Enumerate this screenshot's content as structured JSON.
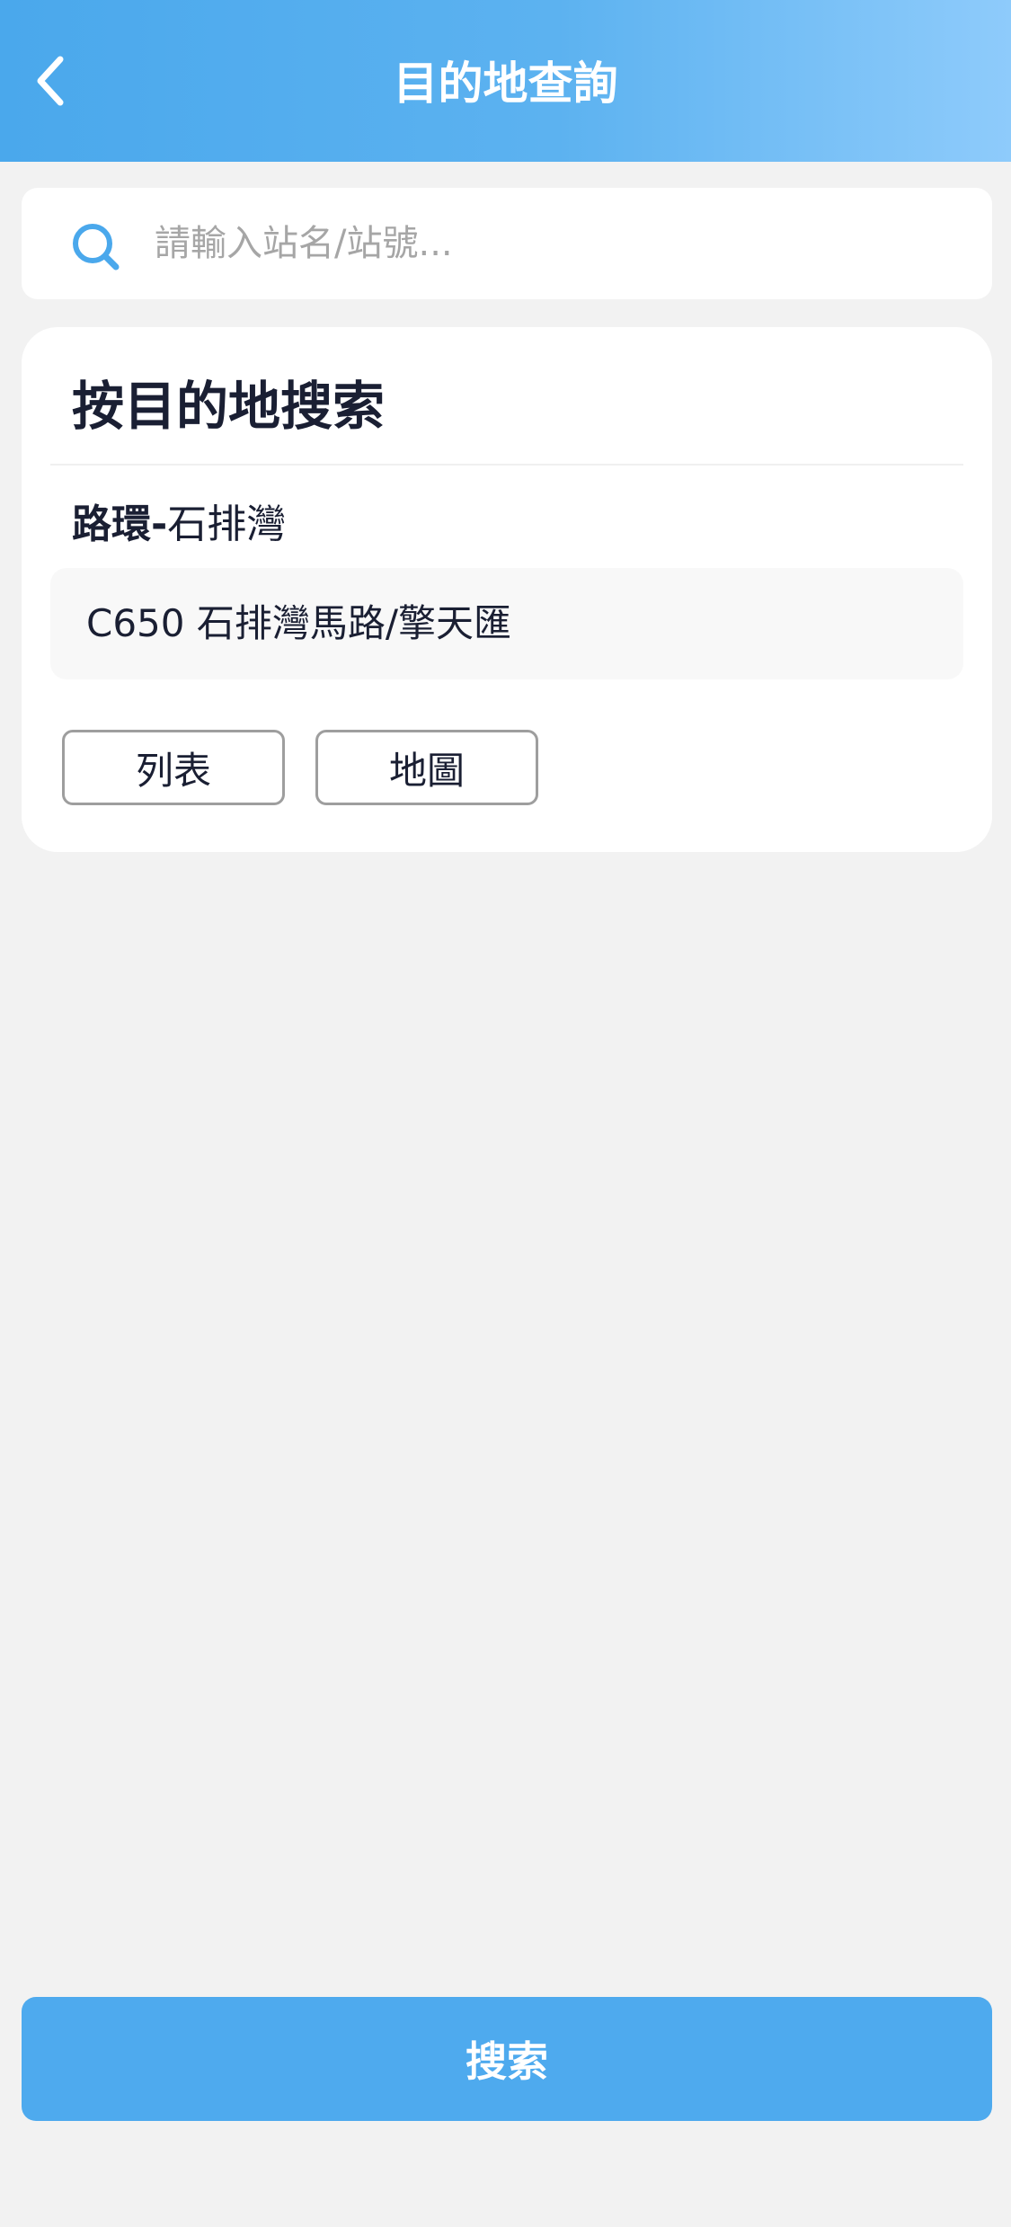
{
  "header": {
    "title": "目的地查詢"
  },
  "search": {
    "placeholder": "請輸入站名/站號..."
  },
  "card": {
    "title": "按目的地搜索",
    "route_label": "路環",
    "route_separator": "-",
    "route_destination": "石排灣",
    "stop": "C650 石排灣馬路/擎天匯",
    "buttons": {
      "list": "列表",
      "map": "地圖"
    }
  },
  "footer": {
    "search_button": "搜索"
  },
  "colors": {
    "header_gradient_start": "#4aa8ec",
    "header_gradient_end": "#8ecbfb",
    "accent": "#4eaaee",
    "icon": "#4aa8ec",
    "background": "#f2f2f2"
  },
  "icons": {
    "back": "chevron-left-icon",
    "search": "search-icon"
  }
}
